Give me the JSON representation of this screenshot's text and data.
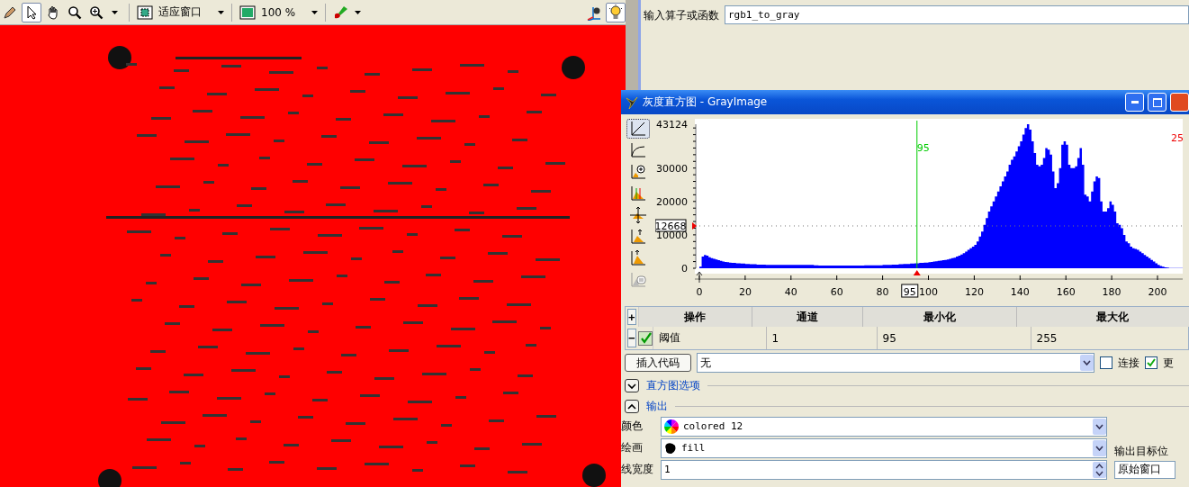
{
  "toolbar": {
    "tools": [
      {
        "kind": "pencil",
        "selected": false
      },
      {
        "kind": "pointer",
        "selected": true
      },
      {
        "kind": "hand",
        "selected": false
      },
      {
        "kind": "magnifier",
        "selected": false
      },
      {
        "kind": "zoom",
        "selected": false
      }
    ],
    "fit_mode": "适应窗口",
    "zoom_level": "100 %",
    "right_tools": [
      {
        "kind": "axes",
        "selected": false
      },
      {
        "kind": "bulb",
        "selected": true
      }
    ]
  },
  "operator_input": {
    "label": "输入算子或函数",
    "value": "rgb1_to_gray"
  },
  "histogram_window": {
    "title": "灰度直方图 - GrayImage",
    "tools": [
      {
        "kind": "linear",
        "selected": true
      },
      {
        "kind": "curve",
        "selected": false
      },
      {
        "kind": "zoom",
        "selected": false
      },
      {
        "kind": "lines",
        "selected": false
      },
      {
        "kind": "move",
        "selected": false
      },
      {
        "kind": "scale",
        "selected": false
      },
      {
        "kind": "stretch",
        "selected": false
      },
      {
        "kind": "export",
        "selected": false
      }
    ],
    "chart_data": {
      "type": "area",
      "xlim": [
        0,
        211
      ],
      "ylim": [
        0,
        43124
      ],
      "ref_lines": [
        {
          "axis": "x",
          "value": 95,
          "color": "#00cc00",
          "label": "95"
        },
        {
          "axis": "y",
          "value": 12668,
          "color": "#777777"
        }
      ],
      "xticks": [
        0,
        20,
        40,
        60,
        80,
        100,
        120,
        140,
        160,
        180,
        200
      ],
      "yticks": [
        0,
        10000,
        20000,
        30000,
        43124
      ],
      "x": [
        0,
        1,
        2,
        3,
        4,
        5,
        6,
        7,
        8,
        9,
        10,
        11,
        12,
        13,
        14,
        15,
        16,
        17,
        18,
        19,
        20,
        21,
        22,
        23,
        24,
        25,
        26,
        27,
        28,
        29,
        30,
        31,
        32,
        33,
        34,
        35,
        36,
        37,
        38,
        39,
        40,
        41,
        42,
        43,
        44,
        45,
        46,
        47,
        48,
        49,
        50,
        51,
        52,
        53,
        54,
        55,
        56,
        57,
        58,
        59,
        60,
        61,
        62,
        63,
        64,
        65,
        66,
        67,
        68,
        69,
        70,
        71,
        72,
        73,
        74,
        75,
        76,
        77,
        78,
        79,
        80,
        81,
        82,
        83,
        84,
        85,
        86,
        87,
        88,
        89,
        90,
        91,
        92,
        93,
        94,
        95,
        96,
        97,
        98,
        99,
        100,
        101,
        102,
        103,
        104,
        105,
        106,
        107,
        108,
        109,
        110,
        111,
        112,
        113,
        114,
        115,
        116,
        117,
        118,
        119,
        120,
        121,
        122,
        123,
        124,
        125,
        126,
        127,
        128,
        129,
        130,
        131,
        132,
        133,
        134,
        135,
        136,
        137,
        138,
        139,
        140,
        141,
        142,
        143,
        144,
        145,
        146,
        147,
        148,
        149,
        150,
        151,
        152,
        153,
        154,
        155,
        156,
        157,
        158,
        159,
        160,
        161,
        162,
        163,
        164,
        165,
        166,
        167,
        168,
        169,
        170,
        171,
        172,
        173,
        174,
        175,
        176,
        177,
        178,
        179,
        180,
        181,
        182,
        183,
        184,
        185,
        186,
        187,
        188,
        189,
        190,
        191,
        192,
        193,
        194,
        195,
        196,
        197,
        198,
        199,
        200,
        201,
        202,
        203,
        204,
        205,
        206,
        207,
        208,
        209,
        210
      ],
      "series": [
        {
          "color": "#0000ff",
          "values": [
            500,
            3500,
            4000,
            3800,
            3300,
            3000,
            2800,
            2600,
            2400,
            2200,
            2000,
            1900,
            1800,
            1700,
            1600,
            1600,
            1500,
            1500,
            1400,
            1400,
            1300,
            1300,
            1200,
            1200,
            1200,
            1100,
            1100,
            1100,
            1100,
            1000,
            1000,
            1000,
            1000,
            1000,
            1000,
            1000,
            1000,
            1000,
            1000,
            1000,
            1000,
            1000,
            1000,
            1000,
            1000,
            1000,
            1000,
            1000,
            1000,
            1000,
            900,
            900,
            800,
            800,
            800,
            800,
            800,
            800,
            800,
            800,
            800,
            800,
            800,
            800,
            800,
            800,
            800,
            800,
            800,
            800,
            800,
            800,
            900,
            900,
            900,
            900,
            900,
            900,
            900,
            900,
            1000,
            1000,
            1000,
            1000,
            1100,
            1100,
            1100,
            1200,
            1200,
            1300,
            1300,
            1300,
            1400,
            1400,
            1500,
            1500,
            1600,
            1600,
            1700,
            1700,
            1800,
            1900,
            2000,
            2100,
            2200,
            2300,
            2400,
            2500,
            2600,
            2800,
            3000,
            3200,
            3500,
            3800,
            4100,
            4500,
            5000,
            5500,
            6000,
            6500,
            7000,
            8000,
            9500,
            11000,
            13000,
            15000,
            17000,
            18500,
            20000,
            21500,
            23000,
            24500,
            26000,
            27500,
            29000,
            31000,
            32500,
            33500,
            35000,
            36500,
            38000,
            40000,
            42000,
            43100,
            41500,
            38000,
            34500,
            31000,
            30500,
            31000,
            33000,
            36000,
            35500,
            34000,
            29000,
            24000,
            25500,
            30000,
            37000,
            38000,
            37000,
            31000,
            30000,
            30000,
            30500,
            33000,
            36000,
            31000,
            22000,
            21500,
            20000,
            23000,
            26000,
            27500,
            27000,
            20000,
            17000,
            17000,
            18000,
            20000,
            19000,
            17000,
            13500,
            13000,
            12000,
            10000,
            8000,
            7500,
            6500,
            6000,
            5800,
            5500,
            5000,
            4500,
            4000,
            3500,
            3000,
            2500,
            2000,
            1500,
            1000,
            700,
            500,
            300,
            200,
            100,
            100,
            100,
            100,
            100,
            100
          ]
        }
      ]
    },
    "max_threshold_label": "25",
    "y_marker": "12668",
    "x_marker": "95"
  },
  "operations_table": {
    "columns": [
      "操作",
      "通道",
      "最小化",
      "最大化"
    ],
    "rows": [
      {
        "operation": "阈值",
        "channel": "1",
        "min": "95",
        "max": "255",
        "enabled": true
      }
    ]
  },
  "add_button": "+",
  "remove_button": "−",
  "insert_code": {
    "button": "插入代码",
    "value": "无"
  },
  "checkboxes": [
    {
      "label": "连接",
      "checked": false
    },
    {
      "label": "更",
      "checked": true
    }
  ],
  "sections": [
    {
      "label": "直方图选项",
      "expanded": false
    },
    {
      "label": "输出",
      "expanded": true
    }
  ],
  "output": {
    "fields": [
      {
        "kind": "color",
        "label": "颜色",
        "value": "colored 12"
      },
      {
        "kind": "draw",
        "label": "绘画",
        "value": "fill"
      },
      {
        "kind": "spin",
        "label": "线宽度",
        "value": "1"
      }
    ],
    "target_label": "输出目标位",
    "target_value": "原始窗口"
  }
}
